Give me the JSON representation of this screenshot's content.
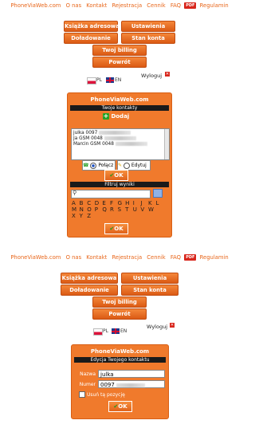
{
  "nav": {
    "site": "PhoneViaWeb.com",
    "about": "O nas",
    "contact": "Kontakt",
    "register": "Rejestracja",
    "pricing": "Cennik",
    "faq": "FAQ",
    "pdf_badge": "PDF",
    "terms": "Regulamin"
  },
  "menu": {
    "address_book": "Książka adresowa",
    "settings": "Ustawienia",
    "topup": "Doładowanie",
    "balance": "Stan konta",
    "billing": "Twoj billing",
    "back": "Powrót"
  },
  "lang": {
    "pl": "PL",
    "en": "EN",
    "logout": "Wyloguj",
    "close_glyph": "✕"
  },
  "contacts_panel": {
    "title": "PhoneViaWeb.com",
    "bar": "Twoje kontakty",
    "add": "Dodaj",
    "items": [
      {
        "label": "julka 0097"
      },
      {
        "label": "Ja GSM 0048"
      },
      {
        "label": "Marcin GSM 0048"
      }
    ],
    "connect": "Połącz",
    "edit": "Edytuj",
    "ok": "OK",
    "filter_bar": "Filtruj wyniki",
    "letters_row1": [
      "A",
      "B",
      "C",
      "D",
      "E",
      "F",
      "G",
      "H",
      "I",
      "J",
      "K",
      "L"
    ],
    "letters_row2": [
      "M",
      "N",
      "O",
      "P",
      "Q",
      "R",
      "S",
      "T",
      "U",
      "V",
      "W"
    ],
    "letters_row3": [
      "X",
      "Y",
      "Z"
    ],
    "ok2": "OK"
  },
  "edit_panel": {
    "title": "PhoneViaWeb.com",
    "bar": "Edycja Twojego kontaktu",
    "name_label": "Nazwa",
    "name_value": "julka",
    "number_label": "Numer",
    "number_value": "0097",
    "delete_label": "Usuń tą pozycję",
    "ok": "OK"
  }
}
